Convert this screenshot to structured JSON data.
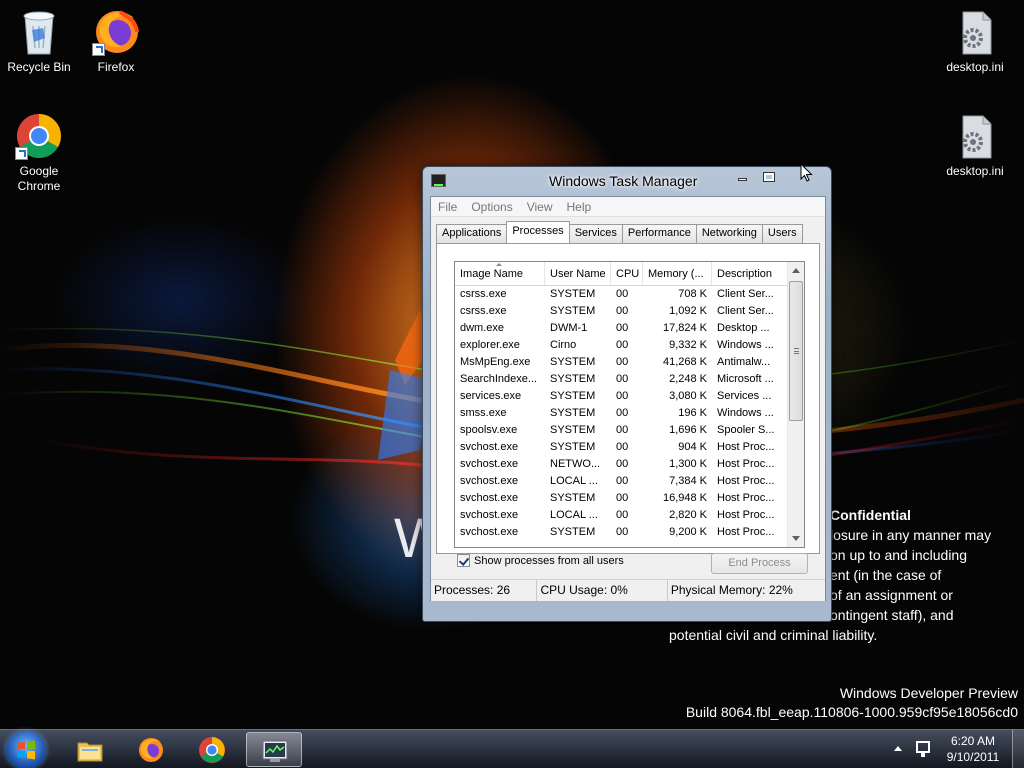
{
  "desktop": {
    "icons": [
      {
        "label": "Recycle Bin"
      },
      {
        "label": "Firefox"
      },
      {
        "label": "Google Chrome"
      },
      {
        "label": "desktop.ini"
      },
      {
        "label": "desktop.ini"
      }
    ]
  },
  "overlay": {
    "confidential_title": "Confidential",
    "confidential_lines": [
      "losure in any manner may",
      "on up to and including",
      "ent (in the case of",
      "of an assignment or",
      "ontingent staff), and",
      "potential civil and criminal liability."
    ],
    "build_line1": "Windows Developer Preview",
    "build_line2": "Build 8064.fbl_eeap.110806-1000.959cf95e18056cd0",
    "logo_fragment": "W"
  },
  "task_manager": {
    "title": "Windows Task Manager",
    "menu": [
      "File",
      "Options",
      "View",
      "Help"
    ],
    "tabs": [
      "Applications",
      "Processes",
      "Services",
      "Performance",
      "Networking",
      "Users"
    ],
    "active_tab": "Processes",
    "columns": [
      "Image Name",
      "User Name",
      "CPU",
      "Memory (...",
      "Description"
    ],
    "rows": [
      [
        "csrss.exe",
        "SYSTEM",
        "00",
        "708 K",
        "Client Ser..."
      ],
      [
        "csrss.exe",
        "SYSTEM",
        "00",
        "1,092 K",
        "Client Ser..."
      ],
      [
        "dwm.exe",
        "DWM-1",
        "00",
        "17,824 K",
        "Desktop ..."
      ],
      [
        "explorer.exe",
        "Cirno",
        "00",
        "9,332 K",
        "Windows ..."
      ],
      [
        "MsMpEng.exe",
        "SYSTEM",
        "00",
        "41,268 K",
        "Antimalw..."
      ],
      [
        "SearchIndexe...",
        "SYSTEM",
        "00",
        "2,248 K",
        "Microsoft ..."
      ],
      [
        "services.exe",
        "SYSTEM",
        "00",
        "3,080 K",
        "Services ..."
      ],
      [
        "smss.exe",
        "SYSTEM",
        "00",
        "196 K",
        "Windows ..."
      ],
      [
        "spoolsv.exe",
        "SYSTEM",
        "00",
        "1,696 K",
        "Spooler S..."
      ],
      [
        "svchost.exe",
        "SYSTEM",
        "00",
        "904 K",
        "Host Proc..."
      ],
      [
        "svchost.exe",
        "NETWO...",
        "00",
        "1,300 K",
        "Host Proc..."
      ],
      [
        "svchost.exe",
        "LOCAL ...",
        "00",
        "7,384 K",
        "Host Proc..."
      ],
      [
        "svchost.exe",
        "SYSTEM",
        "00",
        "16,948 K",
        "Host Proc..."
      ],
      [
        "svchost.exe",
        "LOCAL ...",
        "00",
        "2,820 K",
        "Host Proc..."
      ],
      [
        "svchost.exe",
        "SYSTEM",
        "00",
        "9,200 K",
        "Host Proc..."
      ]
    ],
    "show_all_label": "Show processes from all users",
    "show_all_checked": true,
    "end_process_label": "End Process",
    "status": {
      "processes": "Processes: 26",
      "cpu": "CPU Usage: 0%",
      "memory": "Physical Memory: 22%"
    }
  },
  "taskbar": {
    "clock_time": "6:20 AM",
    "clock_date": "9/10/2011",
    "pinned": [
      "file-explorer-icon",
      "firefox-icon",
      "chrome-icon",
      "task-manager-icon"
    ]
  }
}
